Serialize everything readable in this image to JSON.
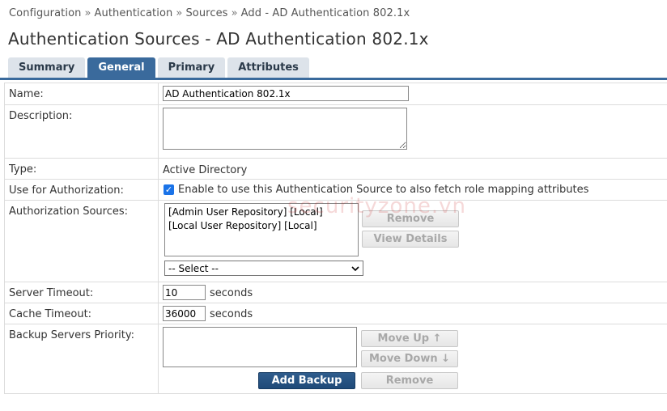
{
  "breadcrumb": {
    "items": [
      "Configuration",
      "Authentication",
      "Sources",
      "Add - AD Authentication 802.1x"
    ],
    "separator": "»"
  },
  "page": {
    "title": "Authentication Sources - AD Authentication 802.1x"
  },
  "tabs": [
    {
      "label": "Summary",
      "active": false
    },
    {
      "label": "General",
      "active": true
    },
    {
      "label": "Primary",
      "active": false
    },
    {
      "label": "Attributes",
      "active": false
    }
  ],
  "form": {
    "name": {
      "label": "Name:",
      "value": "AD Authentication 802.1x"
    },
    "description": {
      "label": "Description:",
      "value": ""
    },
    "type": {
      "label": "Type:",
      "value": "Active Directory"
    },
    "use_for_authorization": {
      "label": "Use for Authorization:",
      "checked": true,
      "text": "Enable to use this Authentication Source to also fetch role mapping attributes"
    },
    "authorization_sources": {
      "label": "Authorization Sources:",
      "items": [
        "[Admin User Repository] [Local]",
        "[Local User Repository] [Local]"
      ],
      "remove_label": "Remove",
      "view_details_label": "View Details",
      "select_value": "-- Select --"
    },
    "server_timeout": {
      "label": "Server Timeout:",
      "value": "10",
      "unit": "seconds"
    },
    "cache_timeout": {
      "label": "Cache Timeout:",
      "value": "36000",
      "unit": "seconds"
    },
    "backup_servers": {
      "label": "Backup Servers Priority:",
      "move_up_label": "Move Up ↑",
      "move_down_label": "Move Down ↓",
      "add_backup_label": "Add Backup",
      "remove_label": "Remove"
    }
  },
  "watermark": {
    "text": "securityzone.vn"
  },
  "colors": {
    "accent": "#3a6a9c",
    "primary_button": "#2f5d8d",
    "tab_inactive": "#dde3ea",
    "checkbox": "#1a73e8"
  }
}
